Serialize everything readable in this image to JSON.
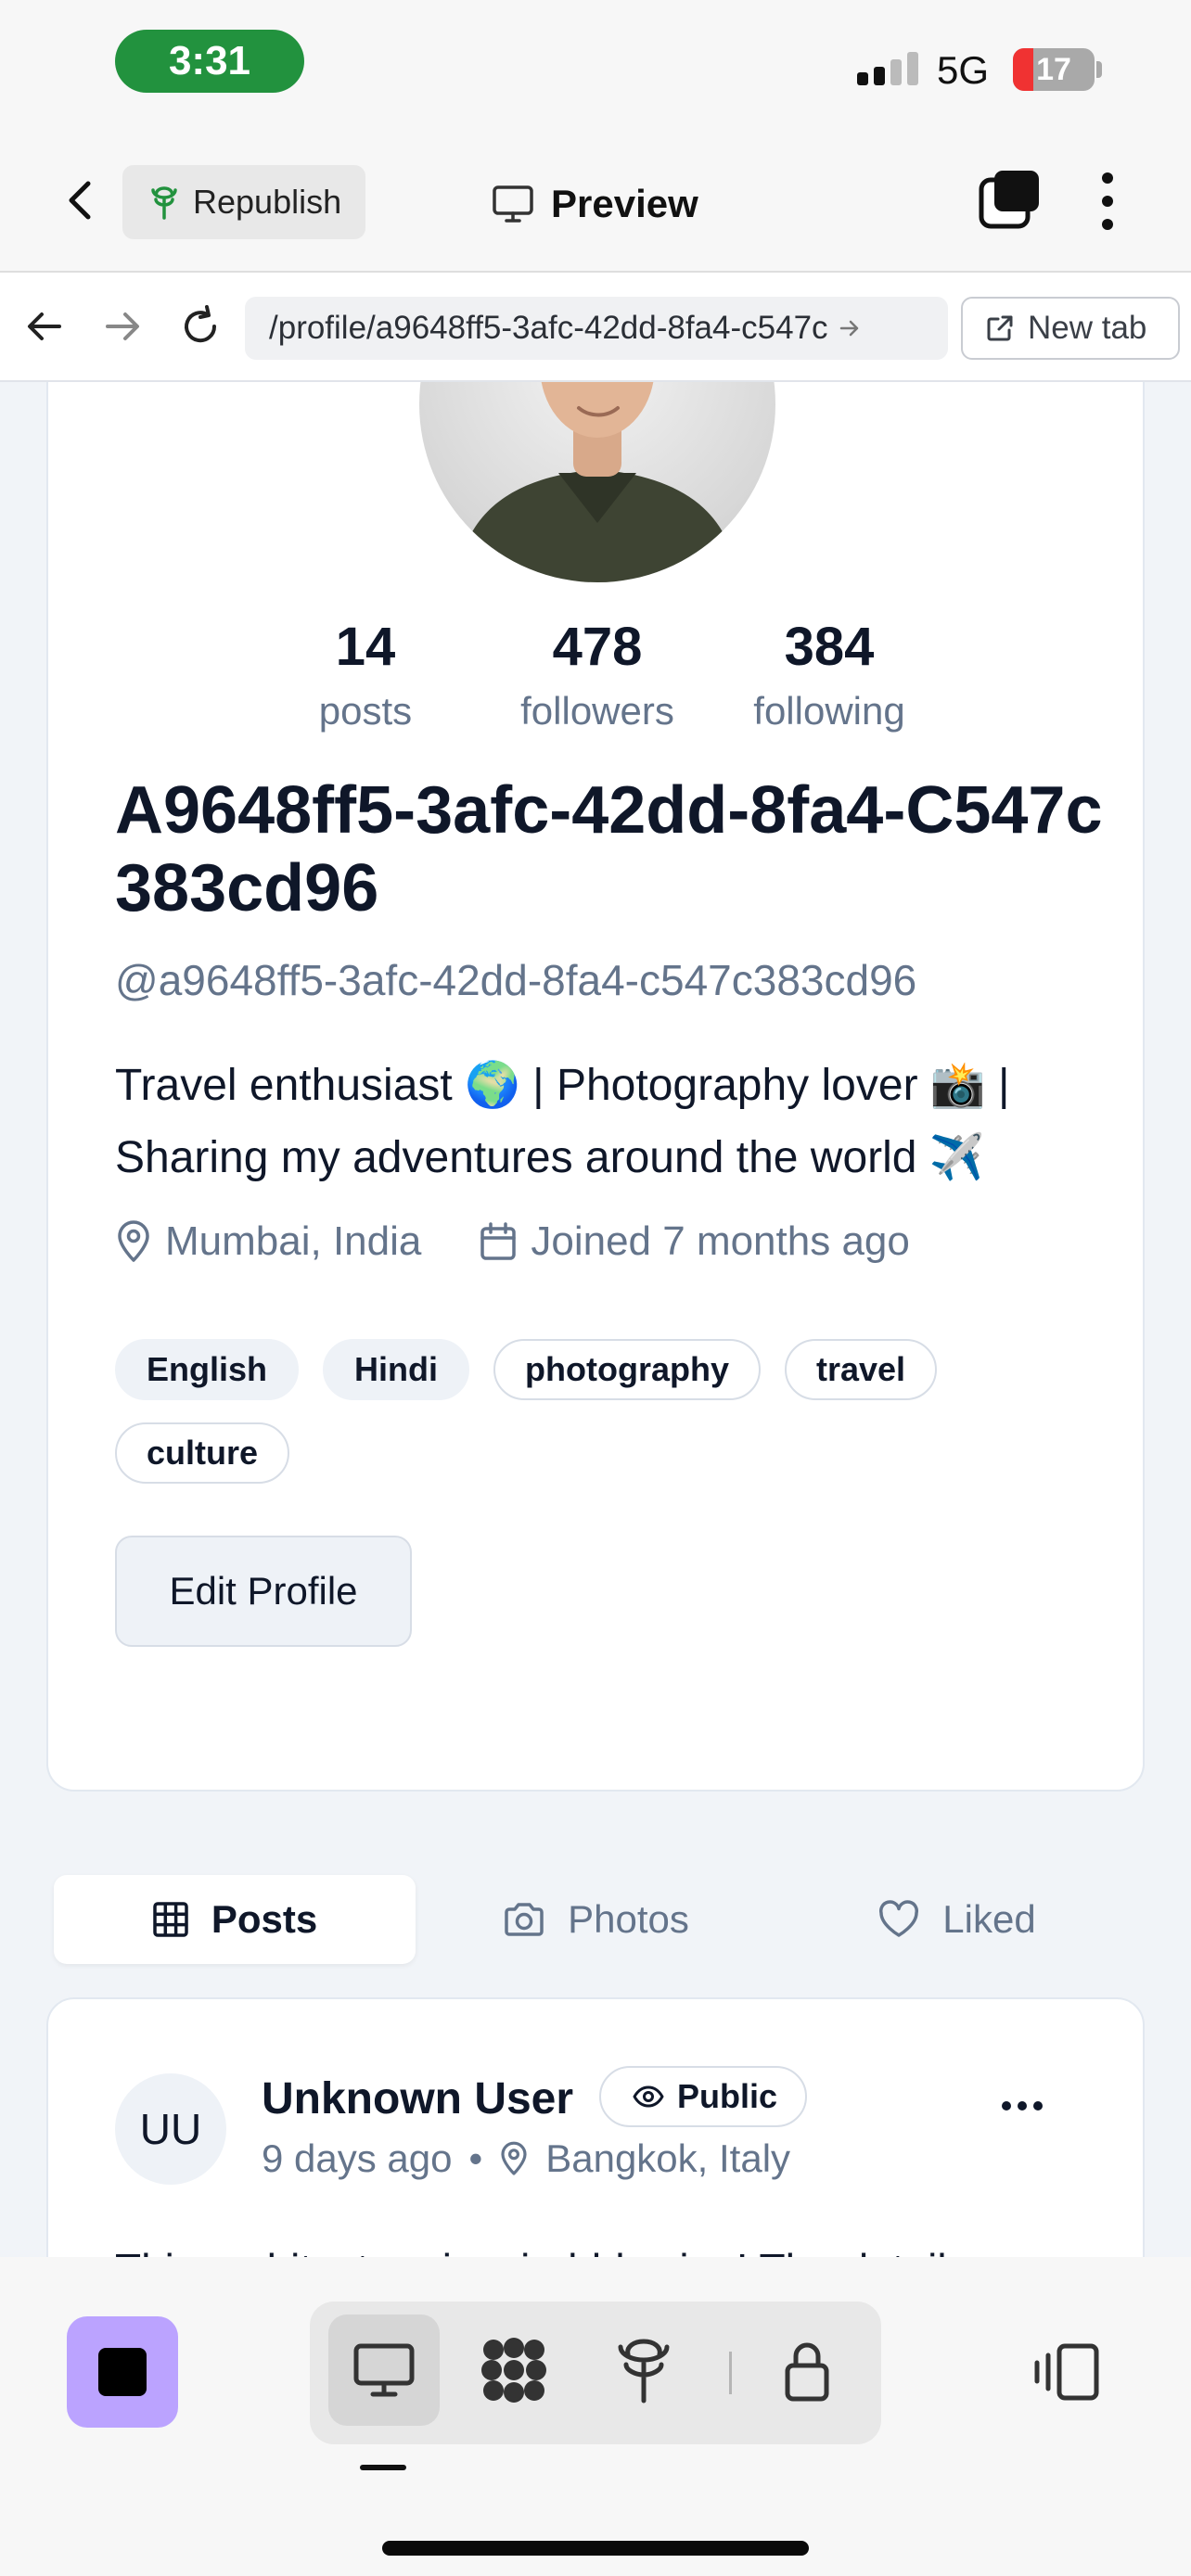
{
  "status_bar": {
    "time": "3:31",
    "network": "5G",
    "battery": "17",
    "battery_level": 0.17
  },
  "toolbar": {
    "republish_label": "Republish",
    "preview_label": "Preview"
  },
  "browser": {
    "url": "/profile/a9648ff5-3afc-42dd-8fa4-c547c",
    "new_tab_label": "New tab"
  },
  "profile": {
    "stats": [
      {
        "value": "14",
        "label": "posts"
      },
      {
        "value": "478",
        "label": "followers"
      },
      {
        "value": "384",
        "label": "following"
      }
    ],
    "display_name": "A9648ff5-3afc-42dd-8fa4-C547c383cd96",
    "handle": "@a9648ff5-3afc-42dd-8fa4-c547c383cd96",
    "bio": "Travel enthusiast 🌍 | Photography lover 📸 | Sharing my adventures around the world ✈️",
    "location": "Mumbai, India",
    "joined": "Joined 7 months ago",
    "tags": [
      {
        "label": "English",
        "style": "filled"
      },
      {
        "label": "Hindi",
        "style": "filled"
      },
      {
        "label": "photography",
        "style": "outline"
      },
      {
        "label": "travel",
        "style": "outline"
      },
      {
        "label": "culture",
        "style": "outline"
      }
    ],
    "edit_label": "Edit Profile"
  },
  "tabs": [
    {
      "label": "Posts",
      "active": true
    },
    {
      "label": "Photos",
      "active": false
    },
    {
      "label": "Liked",
      "active": false
    }
  ],
  "post": {
    "avatar_initials": "UU",
    "author": "Unknown User",
    "visibility": "Public",
    "time": "9 days ago",
    "separator": "•",
    "location": "Bangkok, Italy",
    "text": "This architecture is mind-blowing! The details"
  },
  "colors": {
    "accent_purple": "#bba3ff",
    "time_pill": "#22923e",
    "battery_low": "#f03232"
  }
}
